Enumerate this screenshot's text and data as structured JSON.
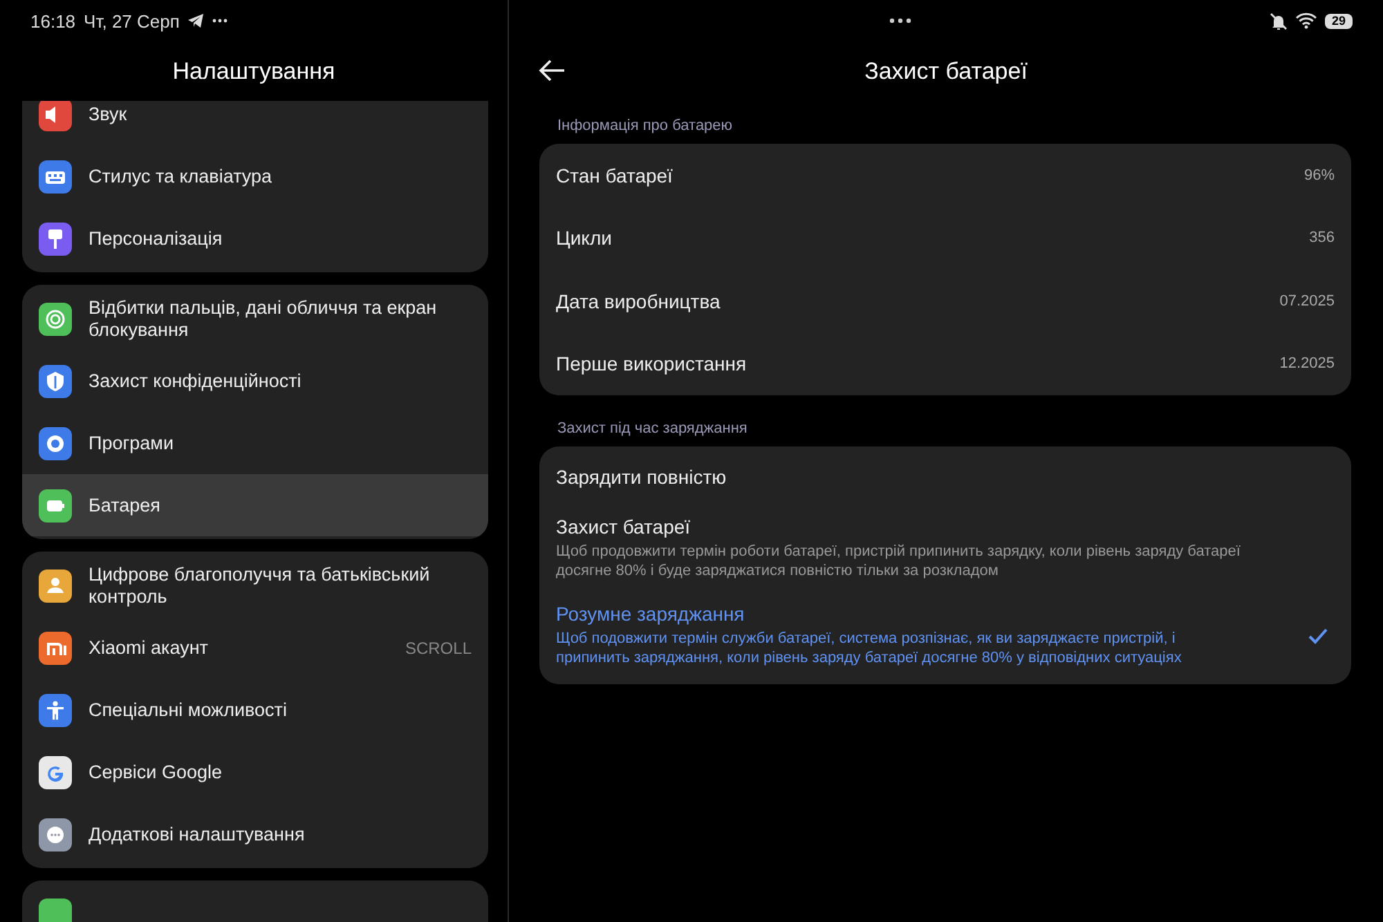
{
  "status_bar": {
    "time": "16:18",
    "date": "Чт, 27 Серп",
    "battery": "29"
  },
  "settings": {
    "title": "Налаштування",
    "groups": [
      {
        "items": [
          {
            "label": "Звук",
            "color": "#e0483e",
            "selected": false
          },
          {
            "label": "Стилус та клавіатура",
            "color": "#3f7be8",
            "selected": false
          },
          {
            "label": "Персоналізація",
            "color": "#7a5cf0",
            "selected": false
          }
        ]
      },
      {
        "items": [
          {
            "label": "Відбитки пальців, дані обличчя та екран блокування",
            "color": "#4fbf5a",
            "selected": false
          },
          {
            "label": "Захист конфіденційності",
            "color": "#3f7be8",
            "selected": false
          },
          {
            "label": "Програми",
            "color": "#3f7be8",
            "selected": false
          },
          {
            "label": "Батарея",
            "color": "#4fbf5a",
            "selected": true
          }
        ]
      },
      {
        "items": [
          {
            "label": "Цифрове благополуччя та батьківський контроль",
            "color": "#e8a73a",
            "selected": false
          },
          {
            "label": "Xiaomi акаунт",
            "color": "#ec6a2c",
            "selected": false,
            "value": "SCROLL"
          },
          {
            "label": "Спеціальні можливості",
            "color": "#3f7be8",
            "selected": false
          },
          {
            "label": "Сервіси Google",
            "color": "#e8e8e8",
            "selected": false
          },
          {
            "label": "Додаткові налаштування",
            "color": "#8e97a8",
            "selected": false
          }
        ]
      },
      {
        "items": [
          {
            "color": "#4fbf5a",
            "selected": false
          }
        ]
      }
    ]
  },
  "detail": {
    "title": "Захист батареї",
    "info_header": "Інформація про батарею",
    "info": [
      {
        "label": "Стан батареї",
        "value": "96%"
      },
      {
        "label": "Цикли",
        "value": "356"
      },
      {
        "label": "Дата виробництва",
        "value": "07.2025"
      },
      {
        "label": "Перше використання",
        "value": "12.2025"
      }
    ],
    "charging_header": "Захист під час заряджання",
    "options": [
      {
        "title": "Зарядити повністю",
        "selected": false
      },
      {
        "title": "Захист батареї",
        "description": "Щоб продовжити термін роботи батареї, пристрій припинить зарядку, коли рівень заряду батареї досягне 80% і буде заряджатися повністю тільки за розкладом",
        "selected": false
      },
      {
        "title": "Розумне заряджання",
        "description": "Щоб подовжити термін служби батареї, система розпізнає, як ви заряджаєте пристрій, і припинить заряджання, коли рівень заряду батареї досягне 80% у відповідних ситуаціях",
        "selected": true
      }
    ]
  }
}
